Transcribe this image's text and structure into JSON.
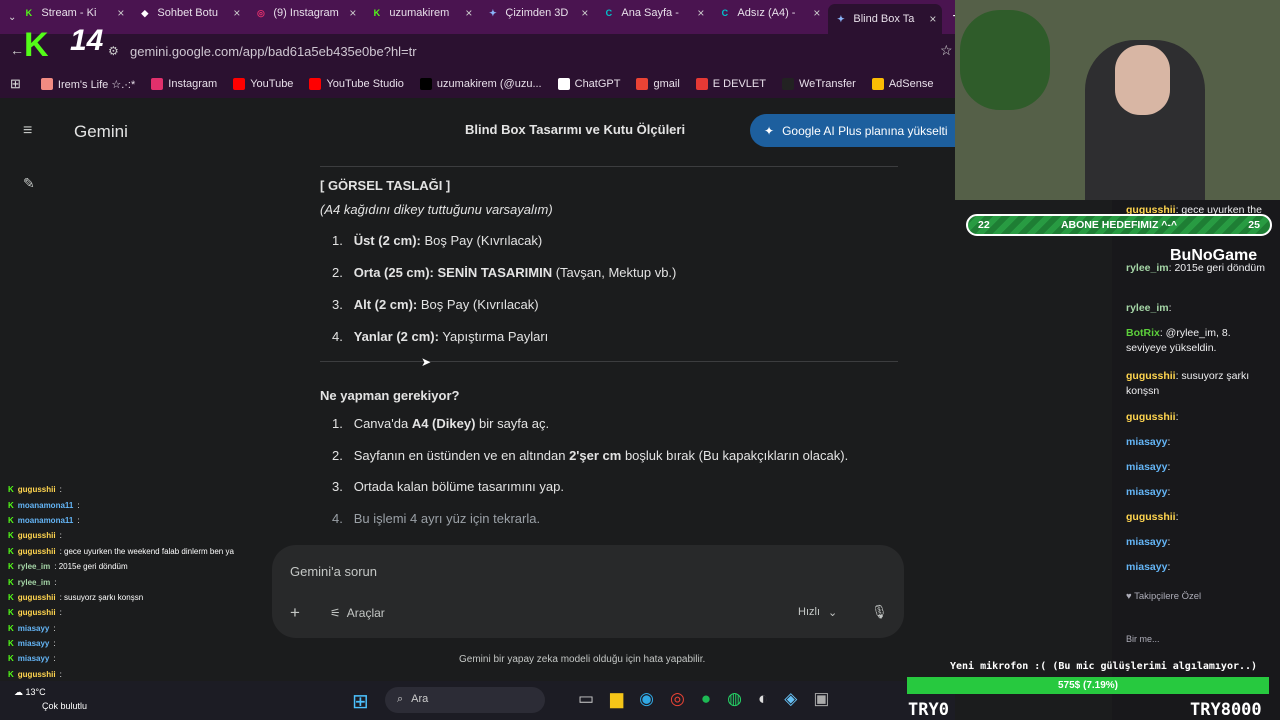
{
  "browser": {
    "tabs": [
      {
        "title": "Stream - Ki",
        "color": "#53fc18",
        "glyph": "K"
      },
      {
        "title": "Sohbet Botu",
        "color": "#ffffff",
        "glyph": "◆"
      },
      {
        "title": "(9) Instagram",
        "color": "#e1306c",
        "glyph": "◎"
      },
      {
        "title": "uzumakirem",
        "color": "#53fc18",
        "glyph": "K"
      },
      {
        "title": "Çizimden 3D",
        "color": "#8ab4f8",
        "glyph": "✦"
      },
      {
        "title": "Ana Sayfa -",
        "color": "#00c4cc",
        "glyph": "C"
      },
      {
        "title": "Adsız (A4) -",
        "color": "#00c4cc",
        "glyph": "C"
      },
      {
        "title": "Blind Box Ta",
        "color": "#8ab4f8",
        "glyph": "✦"
      }
    ],
    "url": "gemini.google.com/app/bad61a5eb435e0be?hl=tr",
    "bookmarks": [
      {
        "label": "Irem's Life ☆.·:*",
        "color": "#f28b82"
      },
      {
        "label": "Instagram",
        "color": "#e1306c"
      },
      {
        "label": "YouTube",
        "color": "#ff0000"
      },
      {
        "label": "YouTube Studio",
        "color": "#ff0000"
      },
      {
        "label": "uzumakirem (@uzu...",
        "color": "#000000"
      },
      {
        "label": "ChatGPT",
        "color": "#ffffff"
      },
      {
        "label": "gmail",
        "color": "#ea4335"
      },
      {
        "label": "E DEVLET",
        "color": "#e53935"
      },
      {
        "label": "WeTransfer",
        "color": "#222222"
      },
      {
        "label": "AdSense",
        "color": "#fbbc04"
      }
    ]
  },
  "gemini": {
    "app_title": "Gemini",
    "conversation_title": "Blind Box Tasarımı ve Kutu Ölçüleri",
    "upgrade_label": "Google AI Plus planına yükselti",
    "section_title": "[ GÖRSEL TASLAĞI ]",
    "section_note": "(A4 kağıdını dikey tuttuğunu varsayalım)",
    "draft_items": [
      {
        "num": "1.",
        "bold": "Üst (2 cm):",
        "text": " Boş Pay (Kıvrılacak)"
      },
      {
        "num": "2.",
        "bold": "Orta (25 cm): SENİN TASARIMIN",
        "text": " (Tavşan, Mektup vb.)"
      },
      {
        "num": "3.",
        "bold": "Alt (2 cm):",
        "text": " Boş Pay (Kıvrılacak)"
      },
      {
        "num": "4.",
        "bold": "Yanlar (2 cm):",
        "text": " Yapıştırma Payları"
      }
    ],
    "question": "Ne yapman gerekiyor?",
    "steps": [
      {
        "num": "1.",
        "pre": "Canva'da ",
        "bold": "A4 (Dikey)",
        "post": " bir sayfa aç."
      },
      {
        "num": "2.",
        "pre": "Sayfanın en üstünden ve en altından ",
        "bold": "2'şer cm",
        "post": " boşluk bırak (Bu kapakçıkların olacak)."
      },
      {
        "num": "3.",
        "pre": "Ortada kalan bölüme tasarımını yap.",
        "bold": "",
        "post": ""
      },
      {
        "num": "4.",
        "pre": "Bu işlemi 4 ayrı yüz için tekrarla.",
        "bold": "",
        "post": ""
      }
    ],
    "prompt_placeholder": "Gemini'a sorun",
    "tools_label": "Araçlar",
    "model_label": "Hızlı",
    "disclaimer": "Gemini bir yapay zeka modeli olduğu için hata yapabilir."
  },
  "taskbar": {
    "search_label": "Ara",
    "weather_temp": "13°C",
    "weather_desc": "Çok bulutlu"
  },
  "overlay": {
    "channel_number": "14",
    "goal_left": "22",
    "goal_text": "ABONE HEDEFIMIZ ^-^",
    "goal_right": "25",
    "brand": "BuNoGame",
    "mic_note": "Yeni mikrofon :( (Bu mic gülüşlerimi algılamıyor..)",
    "sub_progress": "575$ (7.19%)",
    "try_left": "TRY0",
    "try_right": "TRY8000",
    "followers_only": "Takipçilere Özel",
    "send_label": "Bir me..."
  },
  "left_chat": [
    {
      "user": "gugusshii",
      "msg": ":",
      "color": "#ffd54f"
    },
    {
      "user": "moanamona11",
      "msg": ":",
      "color": "#64b5f6"
    },
    {
      "user": "moanamona11",
      "msg": ":",
      "color": "#64b5f6"
    },
    {
      "user": "gugusshii",
      "msg": ":",
      "color": "#ffd54f"
    },
    {
      "user": "gugusshii",
      "msg": ": gece uyurken the weekend falab dinlerm ben ya",
      "color": "#ffd54f"
    },
    {
      "user": "rylee_im",
      "msg": ": 2015e geri döndüm",
      "color": "#a5d6a7"
    },
    {
      "user": "rylee_im",
      "msg": ":",
      "color": "#a5d6a7"
    },
    {
      "user": "gugusshii",
      "msg": ": susuyorz şarkı konşsn",
      "color": "#ffd54f"
    },
    {
      "user": "gugusshii",
      "msg": ":",
      "color": "#ffd54f"
    },
    {
      "user": "miasayy",
      "msg": ":",
      "color": "#64b5f6"
    },
    {
      "user": "miasayy",
      "msg": ":",
      "color": "#64b5f6"
    },
    {
      "user": "miasayy",
      "msg": ":",
      "color": "#64b5f6"
    },
    {
      "user": "gugusshii",
      "msg": ":",
      "color": "#ffd54f"
    },
    {
      "user": "miasayy",
      "msg": ":",
      "color": "#64b5f6"
    },
    {
      "user": "miasayy",
      "msg": ":",
      "color": "#64b5f6"
    }
  ],
  "right_chat": [
    {
      "user": "gugusshii",
      "msg": ": gece uyurken the weekend falab dinlerm ben ya",
      "color": "#ffd54f"
    },
    {
      "user": "rylee_im",
      "msg": ": 2015e geri döndüm",
      "color": "#a5d6a7"
    },
    {
      "user": "rylee_im",
      "msg": ":",
      "color": "#a5d6a7"
    },
    {
      "user": "BotRix",
      "msg": ": @rylee_im, 8. seviyeye yükseldin.",
      "color": "#5ccf3b"
    },
    {
      "user": "gugusshii",
      "msg": ": susuyorz şarkı konşsn",
      "color": "#ffd54f"
    },
    {
      "user": "gugusshii",
      "msg": ":",
      "color": "#ffd54f"
    },
    {
      "user": "miasayy",
      "msg": ":",
      "color": "#64b5f6"
    },
    {
      "user": "miasayy",
      "msg": ":",
      "color": "#64b5f6"
    },
    {
      "user": "miasayy",
      "msg": ":",
      "color": "#64b5f6"
    },
    {
      "user": "gugusshii",
      "msg": ":",
      "color": "#ffd54f"
    },
    {
      "user": "miasayy",
      "msg": ":",
      "color": "#64b5f6"
    },
    {
      "user": "miasayy",
      "msg": ":",
      "color": "#64b5f6"
    }
  ]
}
